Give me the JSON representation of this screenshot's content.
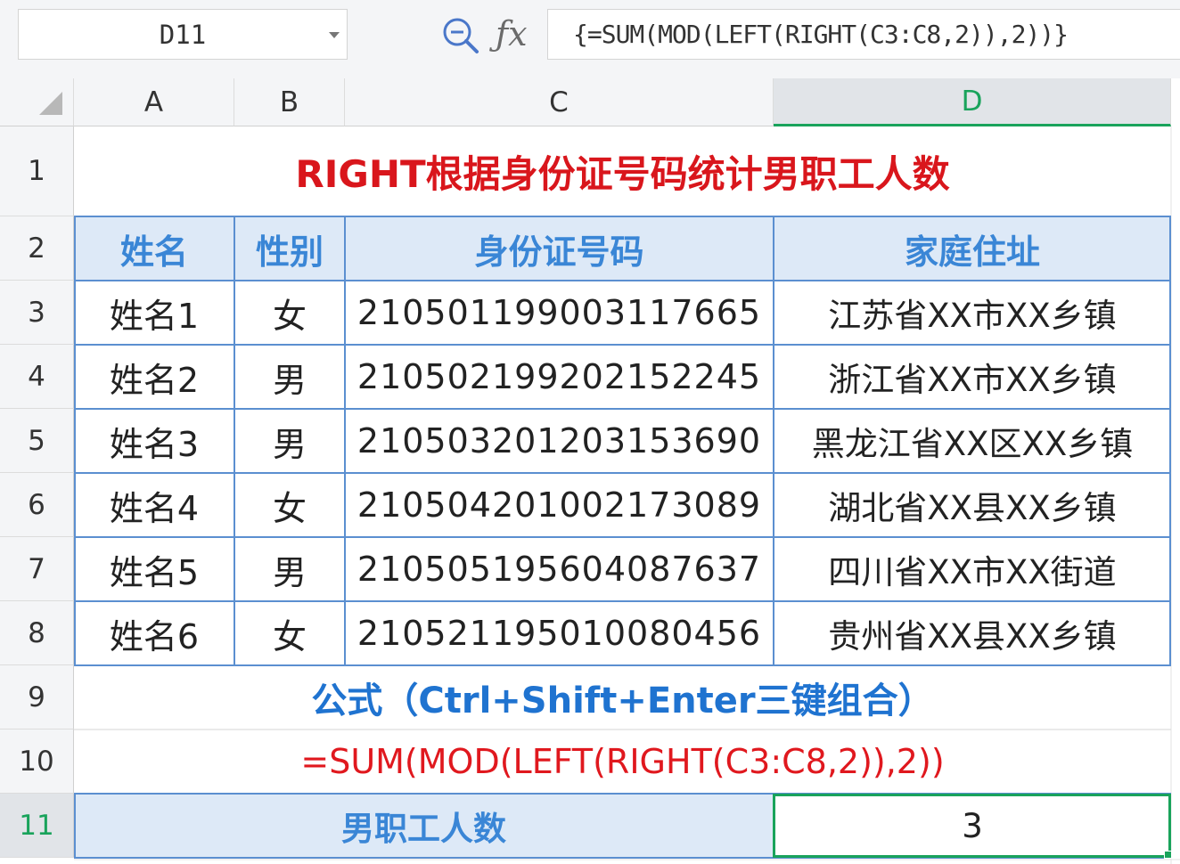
{
  "formula_bar": {
    "name_box": "D11",
    "formula": "{=SUM(MOD(LEFT(RIGHT(C3:C8,2)),2))}"
  },
  "icons": {
    "zoom": "zoom-out-icon",
    "fx": "function-icon",
    "dropdown": "chevron-down-icon"
  },
  "colors": {
    "title_red": "#d9161c",
    "header_blue": "#3a86d6",
    "header_fill": "#dde9f7",
    "selection_green": "#19a35b",
    "grid_line": "#5b8fd0"
  },
  "columns": [
    "A",
    "B",
    "C",
    "D"
  ],
  "rows": [
    "1",
    "2",
    "3",
    "4",
    "5",
    "6",
    "7",
    "8",
    "9",
    "10",
    "11"
  ],
  "sheet": {
    "title": "RIGHT根据身份证号码统计男职工人数",
    "headers": [
      "姓名",
      "性别",
      "身份证号码",
      "家庭住址"
    ],
    "data": [
      [
        "姓名1",
        "女",
        "210501199003117665",
        "江苏省XX市XX乡镇"
      ],
      [
        "姓名2",
        "男",
        "210502199202152245",
        "浙江省XX市XX乡镇"
      ],
      [
        "姓名3",
        "男",
        "210503201203153690",
        "黑龙江省XX区XX乡镇"
      ],
      [
        "姓名4",
        "女",
        "210504201002173089",
        "湖北省XX县XX乡镇"
      ],
      [
        "姓名5",
        "男",
        "210505195604087637",
        "四川省XX市XX街道"
      ],
      [
        "姓名6",
        "女",
        "210521195010080456",
        "贵州省XX县XX乡镇"
      ]
    ],
    "note": "公式（Ctrl+Shift+Enter三键组合）",
    "formula_text": "=SUM(MOD(LEFT(RIGHT(C3:C8,2)),2))",
    "count_label": "男职工人数",
    "count_value": "3"
  },
  "selection": {
    "active_cell": "D11",
    "active_column": "D",
    "active_row": "11"
  }
}
